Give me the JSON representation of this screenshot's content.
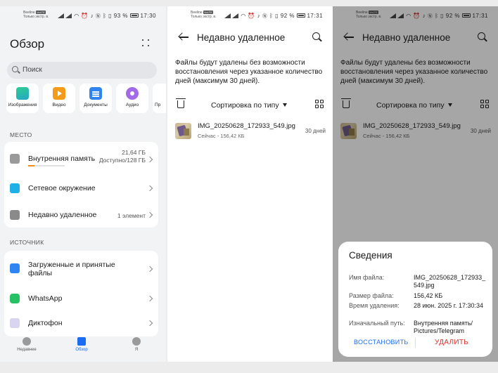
{
  "status_left": {
    "carrier": "Beeline",
    "badge": "VoLTE",
    "note": "Только экстр. в."
  },
  "status_right": {
    "battery_p1": "93 %",
    "battery_p2": "92 %",
    "time_p1": "17:30",
    "time_p2": "17:31"
  },
  "overview": {
    "title": "Обзор",
    "search_placeholder": "Поиск",
    "categories": [
      "Изображения",
      "Видео",
      "Документы",
      "Аудио",
      "Пр"
    ],
    "section_place": "МЕСТО",
    "internal_label": "Внутренняя память",
    "internal_used": "21,64 ГБ",
    "internal_avail": "Доступно/128 ГБ",
    "internal_fill": 0.17,
    "network_label": "Сетевое окружение",
    "recent_label": "Недавно удаленное",
    "recent_count": "1 элемент",
    "section_source": "ИСТОЧНИК",
    "downloads_label": "Загруженные и принятые файлы",
    "whatsapp_label": "WhatsApp",
    "recorder_label": "Диктофон",
    "nav": [
      "Недавнее",
      "Обзор",
      "Я"
    ]
  },
  "recent": {
    "title": "Недавно удаленное",
    "description": "Файлы будут удалены без возможности восстановления через указанное количество дней (максимум 30 дней).",
    "sort_label": "Сортировка по типу",
    "file_name": "IMG_20250628_172933_549.jpg",
    "file_meta": "Сейчас - 156,42 КБ",
    "file_days": "30 дней"
  },
  "details": {
    "title": "Сведения",
    "name_key": "Имя файла:",
    "name_val": "IMG_20250628_172933_549.jpg",
    "size_key": "Размер файла:",
    "size_val": "156,42 КБ",
    "time_key": "Время удаления:",
    "time_val": "28 июн. 2025 г. 17:30:34",
    "path_key": "Изначальный путь:",
    "path_val": "Внутренняя память/ Pictures/Telegram",
    "restore_btn": "ВОССТАНОВИТЬ",
    "delete_btn": "УДАЛИТЬ"
  },
  "colors": {
    "accent_blue": "#1a6cf0",
    "delete_red": "#e0322b",
    "storage_orange": "#f08a1c"
  }
}
